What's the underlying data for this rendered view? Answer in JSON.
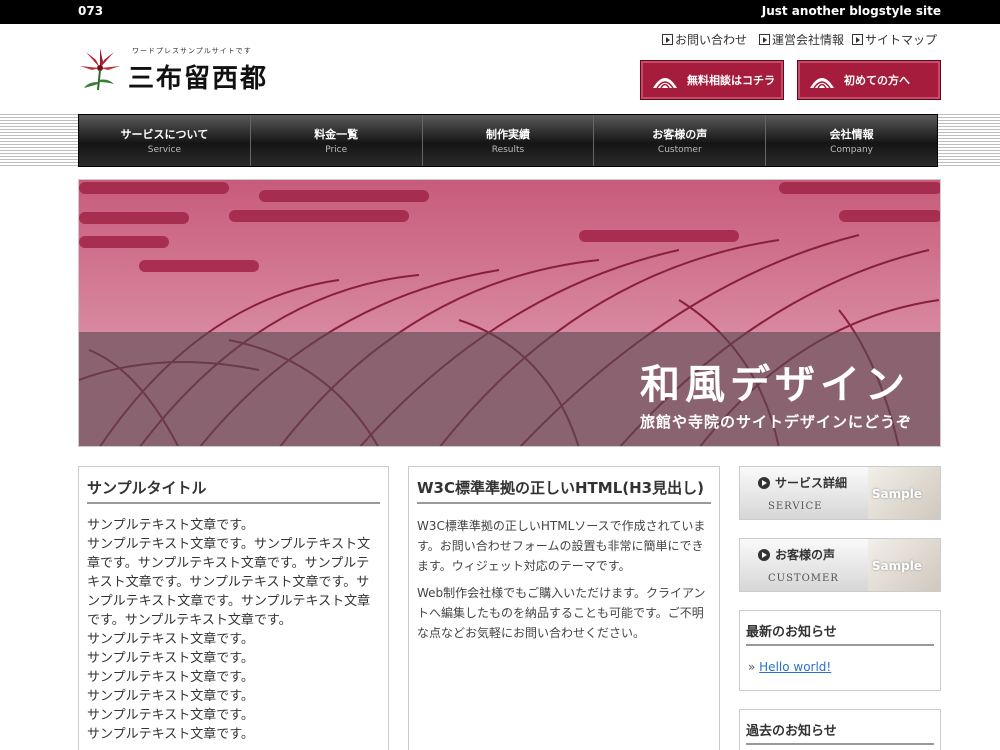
{
  "topbar": {
    "left": "073",
    "right": "Just another blogstyle site"
  },
  "logo": {
    "sub": "ワードプレスサンプルサイトです",
    "name": "三布留西都"
  },
  "util_links": [
    {
      "label": "お問い合わせ"
    },
    {
      "label": "運営会社情報"
    },
    {
      "label": "サイトマップ"
    }
  ],
  "cta": [
    {
      "label": "無料相談はコチラ"
    },
    {
      "label": "初めての方へ"
    }
  ],
  "nav": [
    {
      "jp": "サービスについて",
      "en": "Service"
    },
    {
      "jp": "料金一覧",
      "en": "Price"
    },
    {
      "jp": "制作実績",
      "en": "Results"
    },
    {
      "jp": "お客様の声",
      "en": "Customer"
    },
    {
      "jp": "会社情報",
      "en": "Company"
    }
  ],
  "hero": {
    "title": "和風デザイン",
    "subtitle": "旅館や寺院のサイトデザインにどうぞ"
  },
  "col1": {
    "title": "サンプルタイトル",
    "lines": [
      "サンプルテキスト文章です。",
      "サンプルテキスト文章です。サンプルテキスト文章です。サンプルテキスト文章です。サンプルテキスト文章です。サンプルテキスト文章です。サンプルテキスト文章です。サンプルテキスト文章です。サンプルテキスト文章です。",
      "サンプルテキスト文章です。",
      "サンプルテキスト文章です。",
      "サンプルテキスト文章です。",
      "サンプルテキスト文章です。",
      "サンプルテキスト文章です。",
      "サンプルテキスト文章です。"
    ]
  },
  "col2": {
    "title": "W3C標準準拠の正しいHTML(H3見出し)",
    "p1": "W3C標準準拠の正しいHTMLソースで作成されています。お問い合わせフォームの設置も非常に簡単にできます。ウィジェット対応のテーマです。",
    "p2": "Web制作会社様でもご購入いただけます。クライアントへ編集したものを納品することも可能です。ご不明な点などお気軽にお問い合わせください。"
  },
  "side_banners": [
    {
      "title": "サービス詳細",
      "en": "SERVICE",
      "sample": "Sample"
    },
    {
      "title": "お客様の声",
      "en": "CUSTOMER",
      "sample": "Sample"
    }
  ],
  "news": {
    "title": "最新のお知らせ",
    "link": "Hello world!"
  },
  "past": {
    "title": "過去のお知らせ"
  },
  "colors": {
    "accent": "#a61c3c",
    "hero_pink": "#c75b7c",
    "nav_dark": "#151515"
  }
}
